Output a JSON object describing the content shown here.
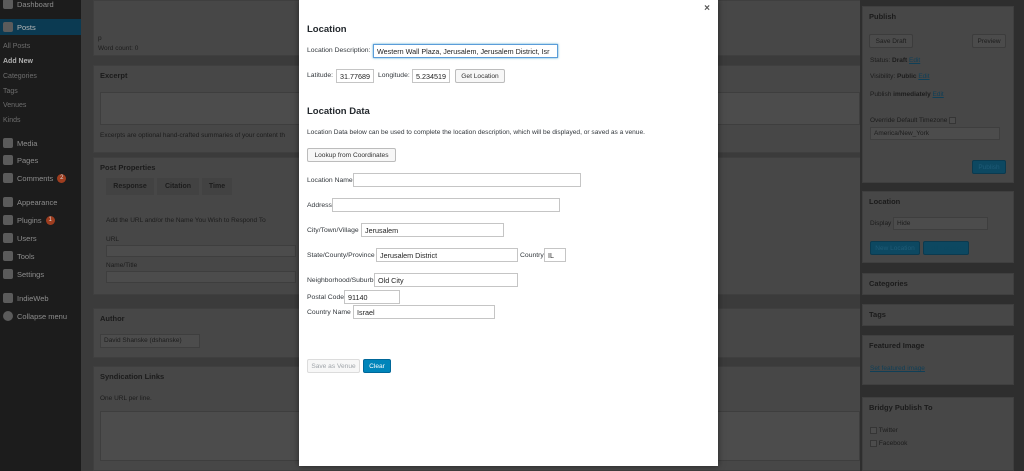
{
  "sidebar": {
    "items": [
      {
        "label": "Dashboard",
        "icon": "dashboard-icon"
      },
      {
        "label": "Posts",
        "icon": "pin-icon"
      },
      {
        "label": "Media",
        "icon": "media-icon"
      },
      {
        "label": "Pages",
        "icon": "pages-icon"
      },
      {
        "label": "Comments",
        "icon": "comments-icon",
        "badge": "2"
      },
      {
        "label": "Appearance",
        "icon": "appearance-icon"
      },
      {
        "label": "Plugins",
        "icon": "plugins-icon",
        "badge": "1"
      },
      {
        "label": "Users",
        "icon": "users-icon"
      },
      {
        "label": "Tools",
        "icon": "tools-icon"
      },
      {
        "label": "Settings",
        "icon": "settings-icon"
      },
      {
        "label": "IndieWeb",
        "icon": "indieweb-icon"
      },
      {
        "label": "Collapse menu",
        "icon": "collapse-icon"
      }
    ],
    "subitems": [
      "All Posts",
      "Add New",
      "Categories",
      "Tags",
      "Venues",
      "Kinds"
    ]
  },
  "editor": {
    "status_p": "p",
    "word_count": "Word count: 0",
    "excerpt": {
      "title": "Excerpt",
      "help": "Excerpts are optional hand-crafted summaries of your content th"
    },
    "post_properties": {
      "title": "Post Properties",
      "tabs": [
        "Response",
        "Citation",
        "Time"
      ],
      "intro": "Add the URL and/or the Name You Wish to Respond To",
      "url_label": "URL",
      "name_label": "Name/Title"
    },
    "author": {
      "title": "Author",
      "selected": "David Shanske (dshanske)"
    },
    "syndication": {
      "title": "Syndication Links",
      "help": "One URL per line."
    }
  },
  "rail": {
    "publish": {
      "title": "Publish",
      "save_draft": "Save Draft",
      "preview": "Preview",
      "status_label": "Status:",
      "status_value": "Draft",
      "visibility_label": "Visibility:",
      "visibility_value": "Public",
      "publish_label": "Publish",
      "publish_value": "immediately",
      "edit": "Edit",
      "override_tz": "Override Default Timezone",
      "timezone": "America/New_York",
      "publish_button": "Publish"
    },
    "location": {
      "title": "Location",
      "display_label": "Display",
      "display_value": "Hide",
      "new_location": "New Location",
      "other_button": "Edit Location"
    },
    "categories": {
      "title": "Categories"
    },
    "tags": {
      "title": "Tags"
    },
    "featured": {
      "title": "Featured Image",
      "link": "Set featured image"
    },
    "bridgy": {
      "title": "Bridgy Publish To",
      "options": [
        "Twitter",
        "Facebook"
      ]
    }
  },
  "modal": {
    "close_glyph": "×",
    "location_heading": "Location",
    "description_label": "Location Description:",
    "description_value": "Western Wall Plaza, Jerusalem, Jerusalem District, Isr",
    "latitude_label": "Latitude:",
    "latitude_value": "31.77689",
    "longitude_label": "Longitude:",
    "longitude_value": "5.234519",
    "get_location": "Get Location",
    "data_heading": "Location Data",
    "data_desc": "Location Data below can be used to complete the location description, which will be displayed, or saved as a venue.",
    "lookup_button": "Lookup from Coordinates",
    "fields": {
      "name_label": "Location Name",
      "name_value": "",
      "address_label": "Address",
      "address_value": "",
      "city_label": "City/Town/Village",
      "city_value": "Jerusalem",
      "state_label": "State/County/Province",
      "state_value": "Jerusalem District",
      "country_label": "Country",
      "country_value": "IL",
      "neighborhood_label": "Neighborhood/Suburb",
      "neighborhood_value": "Old City",
      "postal_label": "Postal Code",
      "postal_value": "91140",
      "country_name_label": "Country Name",
      "country_name_value": "Israel"
    },
    "save_venue": "Save as Venue",
    "clear": "Clear"
  }
}
